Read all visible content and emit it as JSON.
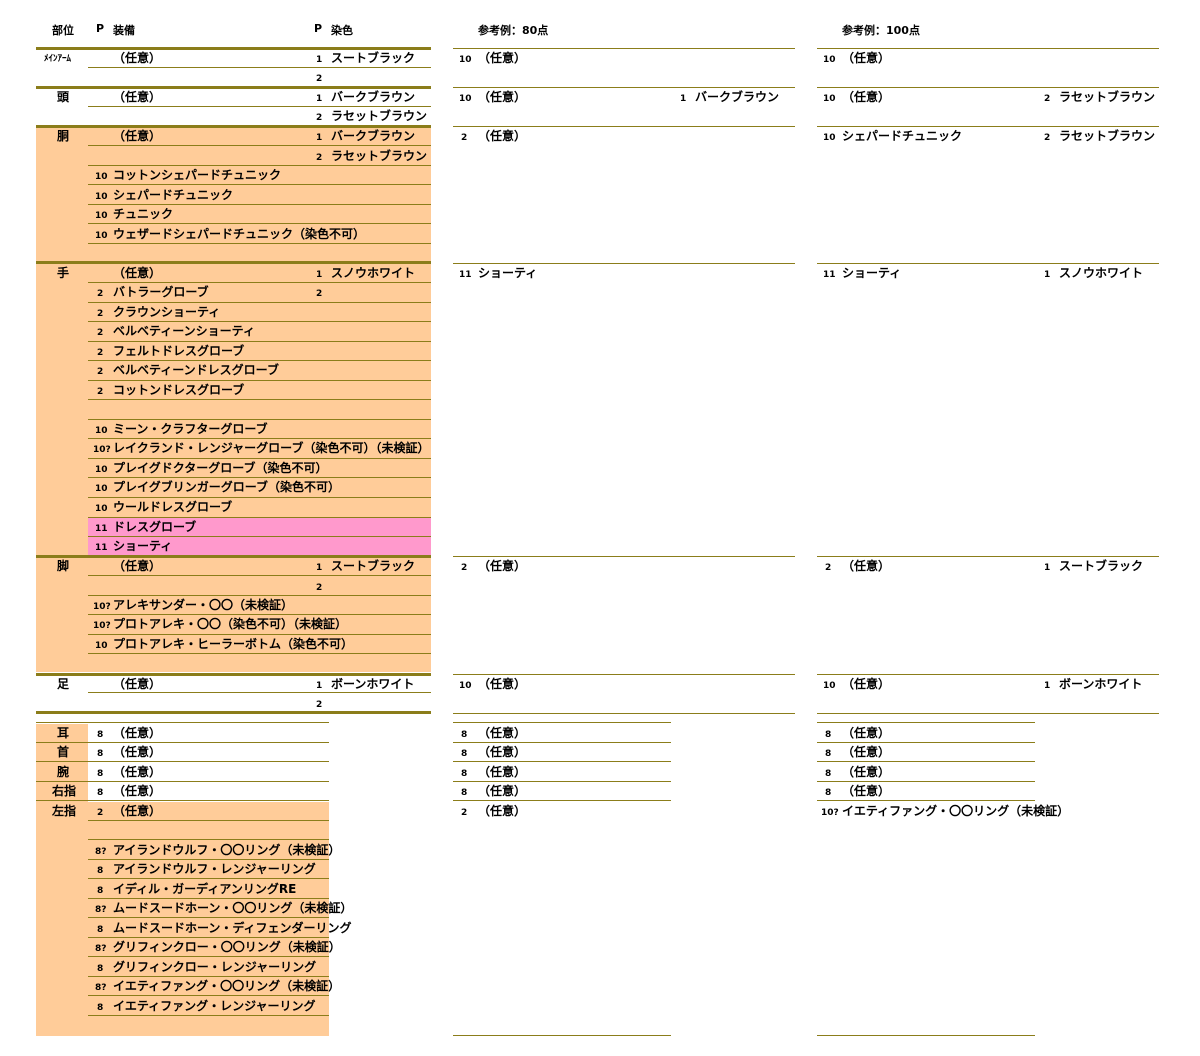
{
  "header": {
    "part": "部位",
    "p": "P",
    "equip": "装備",
    "p2": "P",
    "dye": "染色",
    "ref80": "参考例：80点",
    "ref100": "参考例：100点"
  },
  "labels": {
    "main_arm": "ﾒｲﾝｱｰﾑ",
    "head": "頭",
    "body": "胴",
    "hands": "手",
    "legs": "脚",
    "feet": "足",
    "ears": "耳",
    "neck": "首",
    "wrist": "腕",
    "right_ring": "右指",
    "left_ring": "左指"
  },
  "common": {
    "any": "（任意）"
  },
  "dyes": {
    "soot_black": "スートブラック",
    "bark_brown": "バークブラウン",
    "russet_brown": "ラセットブラウン",
    "snow_white": "スノウホワイト",
    "bone_white": "ボーンホワイト"
  },
  "num": {
    "n1": "1",
    "n2": "2",
    "n8": "8",
    "n10": "10",
    "n11": "11",
    "n8q": "8?",
    "n10q": "10?"
  },
  "body_items": [
    "コットンシェパードチュニック",
    "シェパードチュニック",
    "チュニック",
    "ウェザードシェパードチュニック（染色不可）"
  ],
  "hand_items": [
    "バトラーグローブ",
    "クラウンショーティ",
    "ベルベティーンショーティ",
    "フェルトドレスグローブ",
    "ベルベティーンドレスグローブ",
    "コットンドレスグローブ",
    "ミーン・クラフターグローブ",
    "レイクランド・レンジャーグローブ（染色不可）（未検証）",
    "プレイグドクターグローブ（染色不可）",
    "プレイグブリンガーグローブ（染色不可）",
    "ウールドレスグローブ",
    "ドレスグローブ",
    "ショーティ"
  ],
  "leg_items": [
    "アレキサンダー・〇〇（未検証）",
    "プロトアレキ・〇〇（染色不可）（未検証）",
    "プロトアレキ・ヒーラーボトム（染色不可）"
  ],
  "ring_items": [
    "アイランドウルフ・〇〇リング（未検証）",
    "アイランドウルフ・レンジャーリング",
    "イディル・ガーディアンリングRE",
    "ムードスードホーン・〇〇リング（未検証）",
    "ムードスードホーン・ディフェンダーリング",
    "グリフィンクロー・〇〇リング（未検証）",
    "グリフィンクロー・レンジャーリング",
    "イエティファング・〇〇リング（未検証）",
    "イエティファング・レンジャーリング"
  ],
  "examples": {
    "shepherd_tunic": "シェパードチュニック",
    "shorty": "ショーティ",
    "yeti_ring": "イエティファング・〇〇リング（未検証）"
  },
  "colors": {
    "fill": "#ffcc99",
    "highlight": "#ff99cc",
    "rule": "#8b7d1a"
  }
}
